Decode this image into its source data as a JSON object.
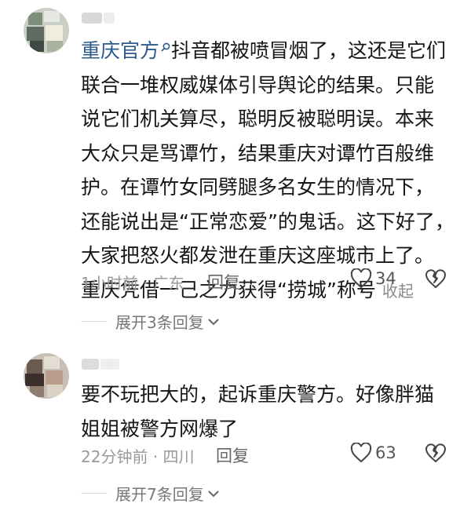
{
  "comments": [
    {
      "user_tag": "重庆官方",
      "text_lines": [
        "抖音都被喷冒烟了，这还是它们",
        "联合一堆权威媒体引导舆论的结果。只能",
        "说它们机关算尽，聪明反被聪明误。本来",
        "大众只是骂谭竹，结果重庆对谭竹百般维",
        "护。在谭竹女同劈腿多名女生的情况下，",
        "还能说出是“正常恋爱”的鬼话。这下好了，",
        "大家把怒火都发泄在重庆这座城市上了。",
        "重庆凭借一己之力获得“捞城”称号"
      ],
      "collapse_label": "收起",
      "meta": "1小时前 · 广东",
      "reply_label": "回复",
      "likes": "34",
      "expand_label": "展开3条回复"
    },
    {
      "text_lines": [
        "要不玩把大的，起诉重庆警方。好像胖猫",
        "姐姐被警方网爆了"
      ],
      "meta": "22分钟前 · 四川",
      "reply_label": "回复",
      "likes": "63",
      "expand_label": "展开7条回复"
    }
  ],
  "colors": {
    "tag": "#2c5a8c",
    "meta": "#999999"
  },
  "icons": [
    "search-icon",
    "heart-outline-icon",
    "broken-heart-icon",
    "chevron-down-icon"
  ]
}
